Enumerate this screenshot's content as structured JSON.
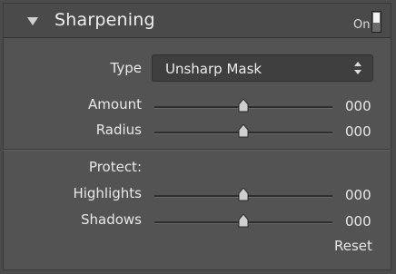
{
  "panel": {
    "title": "Sharpening",
    "on_label": "On",
    "enabled": true
  },
  "type_row": {
    "label": "Type",
    "selected": "Unsharp Mask"
  },
  "sliders": {
    "amount": {
      "label": "Amount",
      "value": "000",
      "position": 0.5
    },
    "radius": {
      "label": "Radius",
      "value": "000",
      "position": 0.5
    },
    "highlights": {
      "label": "Highlights",
      "value": "000",
      "position": 0.5
    },
    "shadows": {
      "label": "Shadows",
      "value": "000",
      "position": 0.5
    }
  },
  "protect_label": "Protect:",
  "reset_label": "Reset",
  "icons": {
    "collapse": "triangle-down-icon",
    "select_arrows": "up-down-arrows-icon"
  },
  "colors": {
    "panel_bg": "#535353",
    "header_bg": "#4a4a4a",
    "text": "#e8e8e8"
  }
}
